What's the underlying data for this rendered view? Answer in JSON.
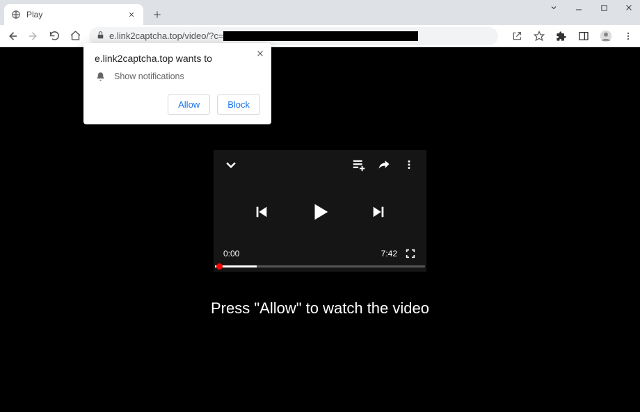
{
  "window": {
    "tab_title": "Play"
  },
  "toolbar": {
    "url_visible": "e.link2captcha.top/video/?c="
  },
  "notification": {
    "title": "e.link2captcha.top wants to",
    "permission_label": "Show notifications",
    "allow_label": "Allow",
    "block_label": "Block"
  },
  "player": {
    "current_time": "0:00",
    "duration": "7:42"
  },
  "page": {
    "caption": "Press \"Allow\" to watch the video"
  }
}
